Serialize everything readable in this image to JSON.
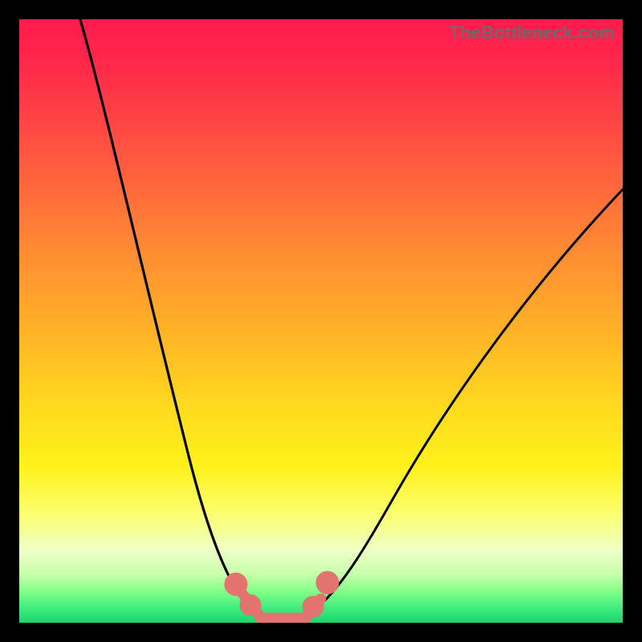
{
  "watermark": {
    "text": "TheBottleneck.com"
  },
  "colors": {
    "page_bg": "#000000",
    "curve": "#000000",
    "marker": "#e2736f",
    "gradient_top": "#ff1a4d",
    "gradient_bottom": "#1fd36a"
  },
  "chart_data": {
    "type": "line",
    "title": "",
    "xlabel": "",
    "ylabel": "",
    "xlim": [
      0,
      100
    ],
    "ylim": [
      0,
      100
    ],
    "note": "Axes are unlabeled in the source image; x/y are normalized 0–100 across the plot area. y is bottleneck magnitude (higher = worse, red zone). Curve minimum ≈ 0 around x ≈ 40–47.",
    "series": [
      {
        "name": "bottleneck-curve",
        "x": [
          10,
          14,
          18,
          22,
          26,
          30,
          34,
          37,
          40,
          43,
          46,
          49,
          52,
          58,
          66,
          76,
          88,
          100
        ],
        "y": [
          100,
          86,
          72,
          58,
          44,
          30,
          16,
          5,
          0,
          0,
          0,
          4,
          10,
          22,
          36,
          50,
          62,
          72
        ]
      }
    ],
    "markers": [
      {
        "shape": "dot",
        "x": 36.5,
        "y": 6,
        "r": 1.6
      },
      {
        "shape": "dot",
        "x": 38.5,
        "y": 2.5,
        "r": 1.3
      },
      {
        "shape": "dot",
        "x": 49.0,
        "y": 2.8,
        "r": 1.3
      },
      {
        "shape": "dot",
        "x": 51.3,
        "y": 7.2,
        "r": 1.6
      }
    ],
    "flat_segment": {
      "x0": 39,
      "x1": 48,
      "y": 0.6
    }
  }
}
